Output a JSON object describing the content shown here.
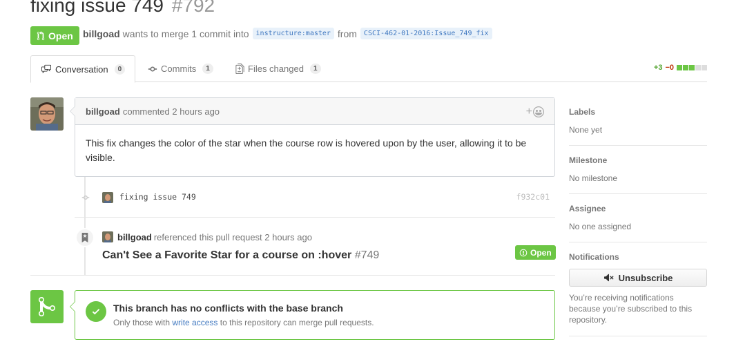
{
  "pr": {
    "title": "fixing issue 749",
    "number": "#792",
    "state": "Open",
    "author": "billgoad",
    "meta_text_1": "wants to merge 1 commit into",
    "base_user": "instructure",
    "base_branch": "master",
    "meta_text_2": "from",
    "head_user": "CSCI-462-01-2016",
    "head_branch": "Issue_749_fix"
  },
  "tabs": [
    {
      "label": "Conversation",
      "count": "0",
      "icon": "comment-discussion-icon"
    },
    {
      "label": "Commits",
      "count": "1",
      "icon": "git-commit-icon"
    },
    {
      "label": "Files changed",
      "count": "1",
      "icon": "diff-icon"
    }
  ],
  "diffstat": {
    "additions": "+3",
    "deletions": "−0",
    "colors": {
      "add": "#6cc644",
      "del": "#bd2c00",
      "neutral": "#ddd"
    }
  },
  "comment": {
    "author": "billgoad",
    "action": "commented 2 hours ago",
    "body": "This fix changes the color of the star when the course row is hovered upon by the user, allowing it to be visible.",
    "reaction_label": "+"
  },
  "commit": {
    "message": "fixing issue 749",
    "sha": "f932c01"
  },
  "reference": {
    "author": "billgoad",
    "action": "referenced this pull request 2 hours ago",
    "issue_title": "Can't See a Favorite Star for a course on :hover",
    "issue_number": "#749",
    "state": "Open"
  },
  "merge": {
    "title": "This branch has no conflicts with the base branch",
    "sub_prefix": "Only those with",
    "sub_link": "write access",
    "sub_suffix": "to this repository can merge pull requests."
  },
  "sidebar": {
    "labels": {
      "heading": "Labels",
      "value": "None yet"
    },
    "milestone": {
      "heading": "Milestone",
      "value": "No milestone"
    },
    "assignee": {
      "heading": "Assignee",
      "value": "No one assigned"
    },
    "notifications": {
      "heading": "Notifications",
      "button": "Unsubscribe",
      "text": "You’re receiving notifications because you’re subscribed to this repository."
    }
  },
  "colors": {
    "accent_green": "#6cc644",
    "link_blue": "#4078c0"
  }
}
